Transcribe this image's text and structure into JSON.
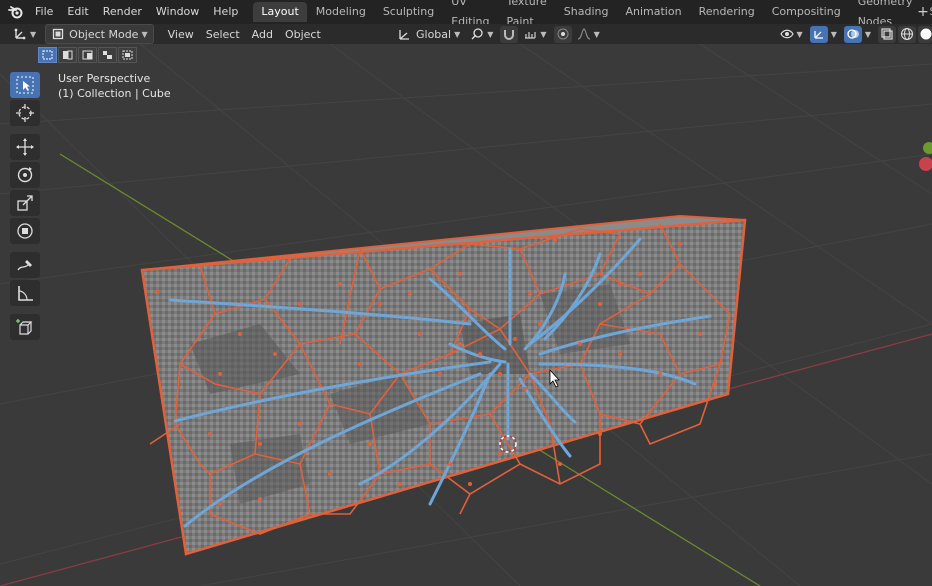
{
  "menu": [
    "File",
    "Edit",
    "Render",
    "Window",
    "Help"
  ],
  "workspaces": [
    "Layout",
    "Modeling",
    "Sculpting",
    "UV Editing",
    "Texture Paint",
    "Shading",
    "Animation",
    "Rendering",
    "Compositing",
    "Geometry Nodes",
    "Scripting"
  ],
  "active_workspace": "Layout",
  "workspace_add": "+",
  "header": {
    "mode": "Object Mode",
    "menus": [
      "View",
      "Select",
      "Add",
      "Object"
    ],
    "orientation": "Global"
  },
  "viewport": {
    "perspective_label": "User Perspective",
    "collection_label": "(1) Collection | Cube"
  },
  "toolbar": {
    "tools": [
      "select-box-tool",
      "cursor-tool",
      "move-tool",
      "rotate-tool",
      "scale-tool",
      "transform-tool",
      "annotate-tool",
      "measure-tool",
      "add-cube-tool"
    ],
    "active_tool": "select-box-tool"
  },
  "colors": {
    "accent": "#4772b3",
    "selection_outline": "#e2603a",
    "stroke_blue": "#6fa6d8",
    "background": "#3a3a3a",
    "grid_line": "#474747",
    "x_axis": "#8a3b45",
    "y_axis": "#6c8a2e"
  }
}
